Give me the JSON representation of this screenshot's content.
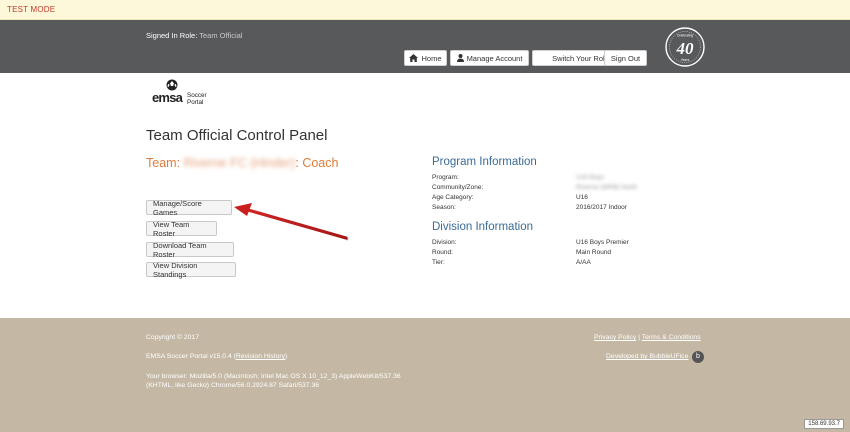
{
  "test_mode": "TEST MODE",
  "header": {
    "role_label": "Signed In Role:",
    "role_value": "Team Official",
    "nav": {
      "home": "Home",
      "account": "Manage Account",
      "switch": "Switch Your Role",
      "signout": "Sign Out"
    },
    "anniversary": {
      "line1": "Celebrating",
      "number": "40",
      "line2": "Years"
    }
  },
  "logo": {
    "word": "emsa",
    "line1": "Soccer",
    "line2": "Portal"
  },
  "page_title": "Team Official Control Panel",
  "team_line": {
    "prefix": "Team:",
    "name": "Riverne FC (Hinder)",
    "suffix": ": Coach"
  },
  "actions": {
    "manage": "Manage/Score Games",
    "roster": "View Team Roster",
    "download": "Download Team Roster",
    "standings": "View Division Standings"
  },
  "program_info": {
    "heading": "Program Information",
    "rows": [
      {
        "label": "Program:",
        "value": "U16 Boys"
      },
      {
        "label": "Community/Zone:",
        "value": "Riverne (WRB) North"
      },
      {
        "label": "Age Category:",
        "value": "U16"
      },
      {
        "label": "Season:",
        "value": "2016/2017 Indoor"
      }
    ]
  },
  "division_info": {
    "heading": "Division Information",
    "rows": [
      {
        "label": "Division:",
        "value": "U16 Boys Premier"
      },
      {
        "label": "Round:",
        "value": "Main Round"
      },
      {
        "label": "Tier:",
        "value": "A/AA"
      }
    ]
  },
  "footer": {
    "copyright": "Copyright © 2017",
    "version_prefix": "EMSA Soccer Portal v15.0.4 (",
    "version_link": "Revision History",
    "version_suffix": ")",
    "browser_line1": "Your browser: Mozilla/5.0 (Macintosh; Intel Mac OS X 10_12_3) AppleWebKit/537.36",
    "browser_line2": "(KHTML, like Gecko) Chrome/56.0.2924.87 Safari/537.36",
    "privacy": "Privacy Policy",
    "separator": "|",
    "terms": "Terms & Conditions",
    "developed": "Developed by BubbleUFice",
    "ip": "158.69.93.7"
  }
}
